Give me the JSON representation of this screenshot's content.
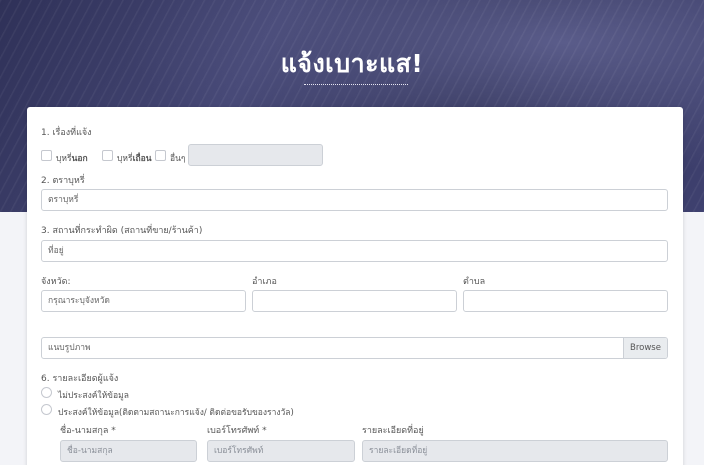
{
  "hero": {
    "title": "แจ้งเบาะแส!"
  },
  "form": {
    "q1": {
      "label": "1. เรื่องที่แจ้ง",
      "options": [
        {
          "pre": "บุหรี่",
          "bold": "นอก"
        },
        {
          "pre": "บุหรี่",
          "bold": "เถื่อน"
        },
        {
          "pre": "อื่นๆ",
          "bold": ""
        }
      ]
    },
    "q2": {
      "label": "2. ตราบุหรี่",
      "value": "ตราบุหรี่"
    },
    "q3": {
      "label": "3. สถานที่กระทำผิด (สถานที่ขาย/ร้านค้า)",
      "value": "ที่อยู่"
    },
    "location": {
      "province_label": "จังหวัด:",
      "province_value": "กรุณาระบุจังหวัด",
      "district_label": "อำเภอ",
      "subdistrict_label": "ตำบล"
    },
    "upload": {
      "placeholder": "แนบรูปภาพ",
      "browse_label": "Browse"
    },
    "q6": {
      "label": "6. รายละเอียดผู้แจ้ง",
      "options": [
        "ไม่ประสงค์ให้ข้อมูล",
        "ประสงค์ให้ข้อมูล(ติดตามสถานะการแจ้ง/ ติดต่อขอรับของรางวัล)"
      ],
      "name_label": "ชื่อ-นามสกุล *",
      "name_placeholder": "ชื่อ-นามสกุล",
      "phone_label": "เบอร์โทรศัพท์ *",
      "phone_placeholder": "เบอร์โทรศัพท์",
      "address_label": "รายละเอียดที่อยู่",
      "address_placeholder": "รายละเอียดที่อยู่"
    }
  }
}
